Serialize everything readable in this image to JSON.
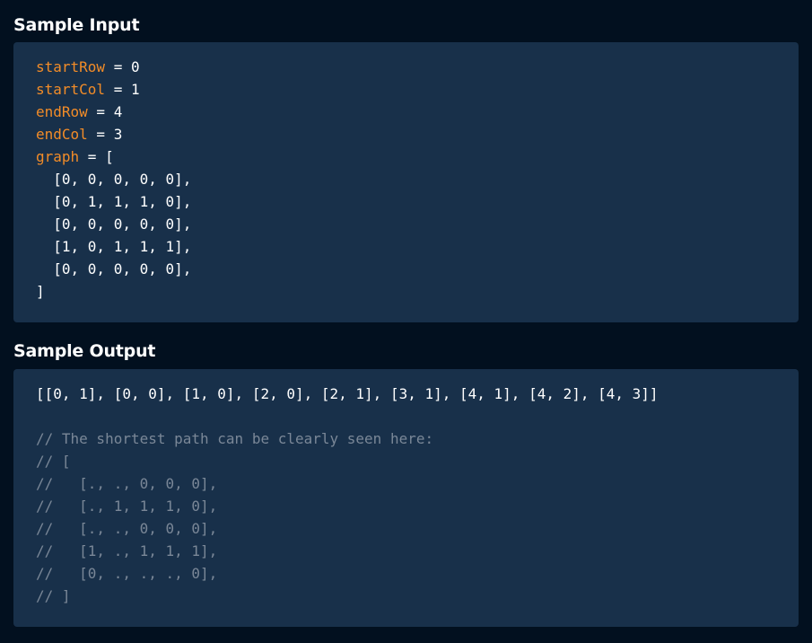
{
  "sample_input": {
    "title": "Sample Input",
    "assignments": [
      {
        "name": "startRow",
        "operator": " = ",
        "value": "0"
      },
      {
        "name": "startCol",
        "operator": " = ",
        "value": "1"
      },
      {
        "name": "endRow",
        "operator": " = ",
        "value": "4"
      },
      {
        "name": "endCol",
        "operator": " = ",
        "value": "3"
      }
    ],
    "graph": {
      "name": "graph",
      "operator": " = [",
      "rows": [
        "  [0, 0, 0, 0, 0],",
        "  [0, 1, 1, 1, 0],",
        "  [0, 0, 0, 0, 0],",
        "  [1, 0, 1, 1, 1],",
        "  [0, 0, 0, 0, 0],"
      ],
      "close": "]"
    }
  },
  "sample_output": {
    "title": "Sample Output",
    "result": "[[0, 1], [0, 0], [1, 0], [2, 0], [2, 1], [3, 1], [4, 1], [4, 2], [4, 3]]",
    "comments": [
      "// The shortest path can be clearly seen here:",
      "// [",
      "//   [., ., 0, 0, 0],",
      "//   [., 1, 1, 1, 0],",
      "//   [., ., 0, 0, 0],",
      "//   [1, ., 1, 1, 1],",
      "//   [0, ., ., ., 0],",
      "// ]"
    ]
  },
  "colors": {
    "page_background": "#02101f",
    "block_background": "#18304a",
    "variable": "#f28c28",
    "text": "#ffffff",
    "comment": "#7a8797"
  }
}
